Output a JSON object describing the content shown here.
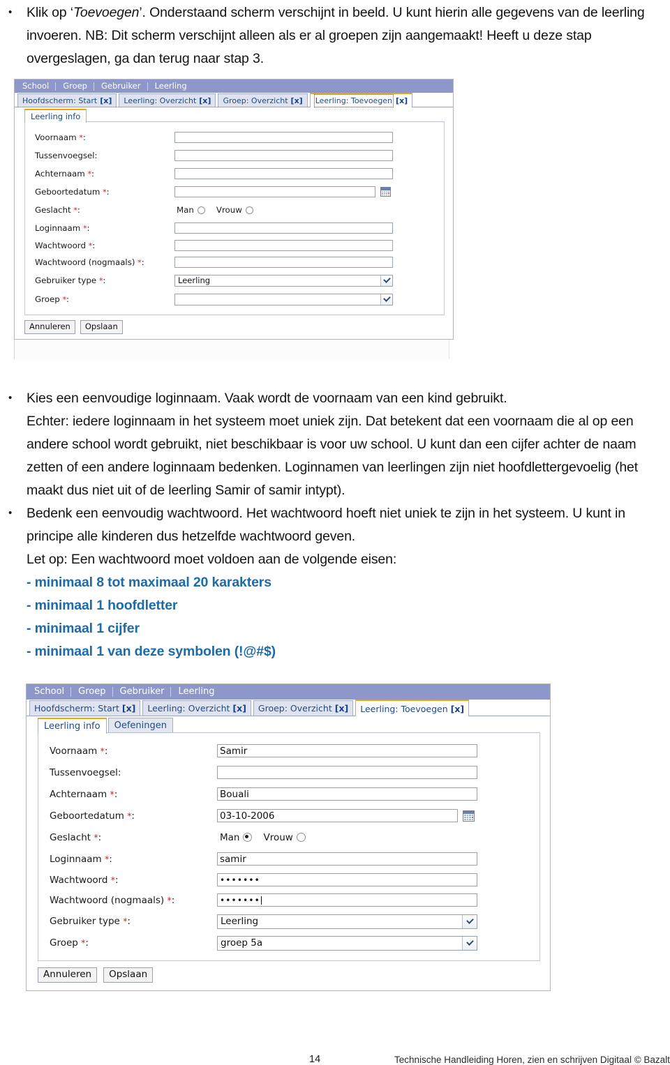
{
  "document": {
    "paragraphs": [
      {
        "type": "bullet",
        "runs": [
          {
            "text": "Klik op ‘",
            "style": "normal"
          },
          {
            "text": "Toevoegen",
            "style": "italic"
          },
          {
            "text": "’.  Onderstaand scherm verschijnt in beeld. U kunt hierin alle gegevens van de leerling invoeren.  NB: Dit scherm verschijnt alleen als er al groepen zijn aangemaakt! Heeft u deze stap overgeslagen, ga dan terug naar stap 3.",
            "style": "normal"
          }
        ]
      }
    ],
    "bullet2": "Kies een eenvoudige loginnaam. Vaak wordt de voornaam van een kind gebruikt.",
    "bullet2_cont": "Echter: iedere loginnaam in het systeem moet uniek zijn. Dat betekent dat een voornaam die al op een andere school wordt gebruikt, niet beschikbaar is voor uw school. U kunt dan een cijfer achter de naam zetten of een andere loginnaam bedenken.   Loginnamen van leerlingen zijn niet hoofdlettergevoelig (het maakt dus niet uit of de leerling Samir of samir intypt).",
    "bullet3": "Bedenk een eenvoudig wachtwoord. Het wachtwoord hoeft niet uniek te zijn in het systeem. U kunt in principe alle kinderen dus hetzelfde wachtwoord geven.",
    "letop": "Let op: Een wachtwoord moet voldoen aan de volgende eisen:",
    "requirements": [
      "- minimaal 8 tot maximaal 20 karakters",
      "- minimaal 1 hoofdletter",
      "- minimaal 1 cijfer",
      "- minimaal 1 van deze symbolen (!@#$)"
    ],
    "requirement_color": "#1b6ca8"
  },
  "footer": {
    "page_number": "14",
    "text": "Technische Handleiding Horen, zien en schrijven Digitaal © Bazalt"
  },
  "screenshot1": {
    "menubar": [
      "School",
      "Groep",
      "Gebruiker",
      "Leerling"
    ],
    "window_tabs": [
      {
        "label": "Hoofdscherm: Start",
        "close": "[x]",
        "active": false
      },
      {
        "label": "Leerling: Overzicht",
        "close": "[x]",
        "active": false
      },
      {
        "label": "Groep: Overzicht",
        "close": "[x]",
        "active": false
      },
      {
        "label": "Leerling: Toevoegen",
        "close": "[x]",
        "active": true
      }
    ],
    "sub_tabs": [
      {
        "label": "Leerling info",
        "active": true
      }
    ],
    "fields": {
      "voornaam_label": "Voornaam",
      "voornaam_value": "",
      "tussenvoegsel_label": "Tussenvoegsel:",
      "tussenvoegsel_value": "",
      "achternaam_label": "Achternaam",
      "achternaam_value": "",
      "geboortedatum_label": "Geboortedatum",
      "geboortedatum_value": "",
      "geslacht_label": "Geslacht",
      "geslacht_man": "Man",
      "geslacht_vrouw": "Vrouw",
      "geslacht_selected": "none",
      "loginnaam_label": "Loginnaam",
      "loginnaam_value": "",
      "wachtwoord_label": "Wachtwoord",
      "wachtwoord_value": "",
      "wachtwoord2_label": "Wachtwoord (nogmaals)",
      "wachtwoord2_value": "",
      "gebruikertype_label": "Gebruiker type",
      "gebruikertype_value": "Leerling",
      "groep_label": "Groep",
      "groep_value": ""
    },
    "buttons": {
      "cancel": "Annuleren",
      "save": "Opslaan"
    }
  },
  "screenshot2": {
    "menubar": [
      "School",
      "Groep",
      "Gebruiker",
      "Leerling"
    ],
    "window_tabs": [
      {
        "label": "Hoofdscherm: Start",
        "close": "[x]",
        "active": false
      },
      {
        "label": "Leerling: Overzicht",
        "close": "[x]",
        "active": false
      },
      {
        "label": "Groep: Overzicht",
        "close": "[x]",
        "active": false
      },
      {
        "label": "Leerling: Toevoegen",
        "close": "[x]",
        "active": true
      }
    ],
    "sub_tabs": [
      {
        "label": "Leerling info",
        "active": true
      },
      {
        "label": "Oefeningen",
        "active": false
      }
    ],
    "fields": {
      "voornaam_label": "Voornaam",
      "voornaam_value": "Samir",
      "tussenvoegsel_label": "Tussenvoegsel:",
      "tussenvoegsel_value": "",
      "achternaam_label": "Achternaam",
      "achternaam_value": "Bouali",
      "geboortedatum_label": "Geboortedatum",
      "geboortedatum_value": "03-10-2006",
      "geslacht_label": "Geslacht",
      "geslacht_man": "Man",
      "geslacht_vrouw": "Vrouw",
      "geslacht_selected": "Man",
      "loginnaam_label": "Loginnaam",
      "loginnaam_value": "samir",
      "wachtwoord_label": "Wachtwoord",
      "wachtwoord_value": "•••••••",
      "wachtwoord2_label": "Wachtwoord (nogmaals)",
      "wachtwoord2_value": "•••••••",
      "gebruikertype_label": "Gebruiker type",
      "gebruikertype_value": "Leerling",
      "groep_label": "Groep",
      "groep_value": "groep 5a"
    },
    "buttons": {
      "cancel": "Annuleren",
      "save": "Opslaan"
    }
  }
}
